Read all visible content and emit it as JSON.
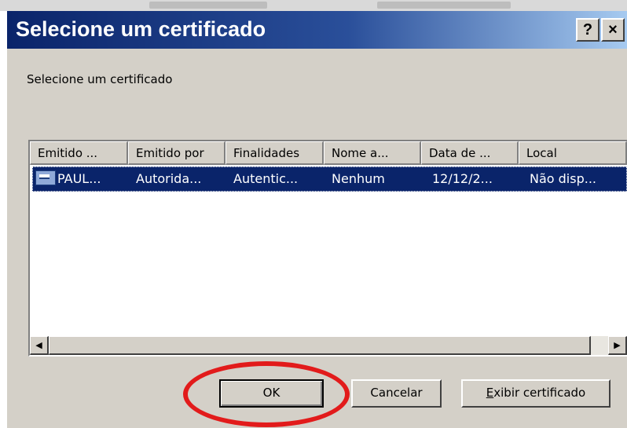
{
  "window": {
    "title": "Selecione um certificado",
    "help_glyph": "?",
    "close_glyph": "×"
  },
  "prompt": "Selecione um certificado",
  "list": {
    "columns": [
      "Emitido ...",
      "Emitido por",
      "Finalidades",
      "Nome a...",
      "Data de ...",
      "Local"
    ],
    "rows": [
      {
        "icon": "certificate-icon",
        "selected": true,
        "cells": [
          "PAUL...",
          "Autorida...",
          "Autentic...",
          "Nenhum",
          "12/12/2...",
          "Não disp..."
        ]
      }
    ]
  },
  "scrollbar": {
    "left_glyph": "◀",
    "right_glyph": "▶"
  },
  "buttons": {
    "ok": "OK",
    "cancel": "Cancelar",
    "view_prefix": "E",
    "view_rest": "xibir certificado"
  },
  "colors": {
    "title_gradient_start": "#0a246a",
    "title_gradient_end": "#a6caf0",
    "selection": "#0a246a",
    "face": "#d4d0c8",
    "annotation": "#e21b1b"
  }
}
